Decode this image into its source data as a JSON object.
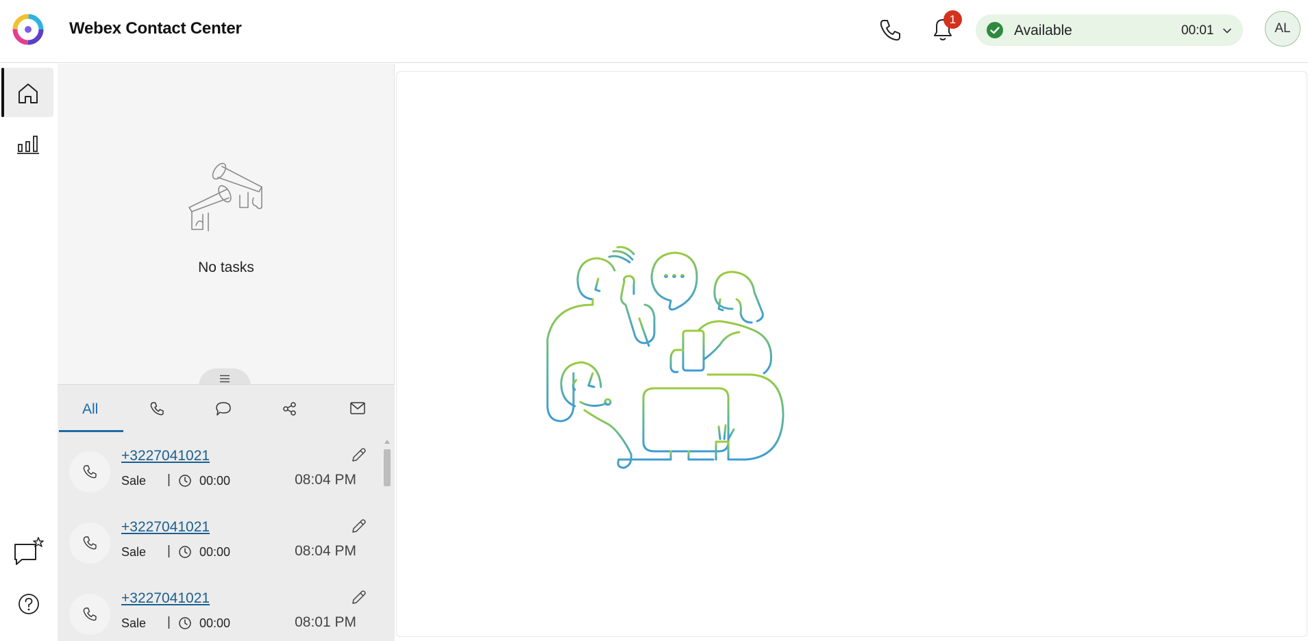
{
  "header": {
    "app_title": "Webex Contact Center",
    "notification_count": "1",
    "status": {
      "label": "Available",
      "timer": "00:01"
    },
    "avatar_initials": "AL",
    "icons": [
      "webex-logo",
      "phone-icon",
      "bell-icon",
      "check-icon",
      "chevron-down-icon"
    ]
  },
  "leftnav": {
    "items": [
      {
        "name": "home",
        "icon": "home-icon",
        "active": true
      },
      {
        "name": "statistics",
        "icon": "bar-chart-icon",
        "active": false
      },
      {
        "name": "feedback",
        "icon": "chat-star-icon",
        "active": false
      },
      {
        "name": "help",
        "icon": "help-icon",
        "active": false
      }
    ]
  },
  "taskpanel": {
    "empty_text": "No tasks",
    "tabs": [
      {
        "label": "All",
        "selected": true
      },
      {
        "icon": "phone-icon"
      },
      {
        "icon": "chat-icon"
      },
      {
        "icon": "share-icon"
      },
      {
        "icon": "email-icon"
      }
    ],
    "tasks": [
      {
        "number": "+3227041021",
        "queue": "Sale",
        "separator": "|",
        "duration": "00:00",
        "time": "08:04 PM"
      },
      {
        "number": "+3227041021",
        "queue": "Sale",
        "separator": "|",
        "duration": "00:00",
        "time": "08:04 PM"
      },
      {
        "number": "+3227041021",
        "queue": "Sale",
        "separator": "|",
        "duration": "00:00",
        "time": "08:01 PM"
      }
    ]
  },
  "colors": {
    "accent": "#1b6ba5",
    "status_bg": "#e7f4e6",
    "status_green": "#2e8a3e",
    "badge_red": "#d2321e"
  }
}
